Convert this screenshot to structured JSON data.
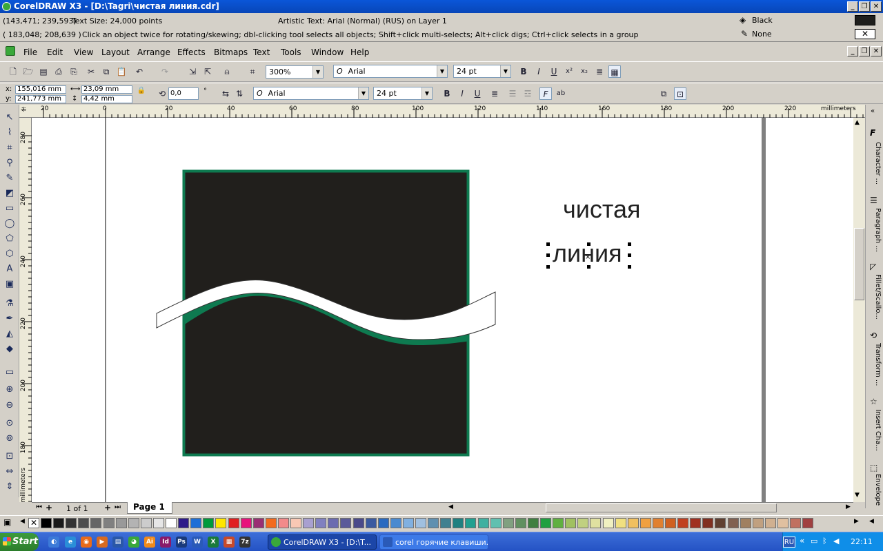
{
  "window": {
    "title": "CorelDRAW X3 - [D:\\Tagri\\чистая линия.cdr]"
  },
  "status": {
    "coords1": "(143,471; 239,593)",
    "text_size": "Text Size: 24,000 points",
    "object_info": "Artistic Text: Arial (Normal) (RUS) on Layer 1",
    "coords2": "( 183,048; 208,639 )",
    "hint": "Click an object twice for rotating/skewing; dbl-clicking tool selects all objects; Shift+click multi-selects; Alt+click digs; Ctrl+click selects in a group",
    "fill_label": "Black",
    "outline_label": "None",
    "fill_color": "#1e1e1c"
  },
  "menu": [
    "File",
    "Edit",
    "View",
    "Layout",
    "Arrange",
    "Effects",
    "Bitmaps",
    "Text",
    "Tools",
    "Window",
    "Help"
  ],
  "standard_toolbar": {
    "zoom": "300%",
    "font": "Arial",
    "font_size": "24 pt"
  },
  "property_bar": {
    "x": "155,016 mm",
    "y": "241,773 mm",
    "width": "23,09 mm",
    "height": "4,42 mm",
    "angle": "0,0",
    "angle_unit": "°",
    "font": "Arial",
    "font_size": "24 pt"
  },
  "rulers": {
    "unit": "millimeters",
    "h_ticks": [
      "20",
      "0",
      "20",
      "40",
      "60",
      "80",
      "100",
      "120",
      "140",
      "160",
      "180",
      "200",
      "220"
    ],
    "v_ticks": [
      "280",
      "260",
      "240",
      "220",
      "200",
      "180"
    ],
    "v_unit": "millimeters"
  },
  "canvas": {
    "text_line1": "чистая",
    "text_line2": "линия",
    "square_fill": "#211f1c",
    "square_stroke": "#0e7a50"
  },
  "pagebar": {
    "count": "1 of 1",
    "page_tab": "Page 1"
  },
  "docker_tabs": [
    "Character ...",
    "Paragraph ...",
    "Fillet/Scallo...",
    "Transform ...",
    "Insert Cha...",
    "Envelope"
  ],
  "palette": [
    "#000000",
    "#1a1a1a",
    "#333333",
    "#4d4d4d",
    "#666666",
    "#808080",
    "#999999",
    "#b3b3b3",
    "#cccccc",
    "#e6e6e6",
    "#ffffff",
    "#2e1a8a",
    "#1f6fd6",
    "#009a3c",
    "#ffe600",
    "#e02020",
    "#e8127c",
    "#9a2f73",
    "#f26b1d",
    "#f28a8a",
    "#f9c8b4",
    "#a8a0d0",
    "#8080c0",
    "#6b6bb0",
    "#5a5a9a",
    "#4a4a8a",
    "#3a5aa0",
    "#2a6ac0",
    "#4a8ad0",
    "#80b0e0",
    "#a0c0e0",
    "#6090b0",
    "#408090",
    "#208080",
    "#20a090",
    "#40b0a0",
    "#60c0b0",
    "#80a080",
    "#609060",
    "#408040",
    "#20a040",
    "#60b040",
    "#a0c060",
    "#c0d080",
    "#e0e0a0",
    "#f0f0c0",
    "#f0e080",
    "#f0c060",
    "#f0a040",
    "#e08030",
    "#d06020",
    "#c04020",
    "#a03020",
    "#803020",
    "#604030",
    "#806050",
    "#a08060",
    "#c0a080",
    "#d0b090",
    "#e0c0a0",
    "#c07060",
    "#a04040"
  ],
  "taskbar": {
    "start": "Start",
    "tasks": [
      "CorelDRAW X3 - [D:\\T...",
      "corel горячие клавиши...."
    ],
    "lang": "RU",
    "clock": "22:11",
    "quick": [
      "Ai",
      "Id",
      "Ps",
      "W",
      "X",
      "7z"
    ]
  }
}
